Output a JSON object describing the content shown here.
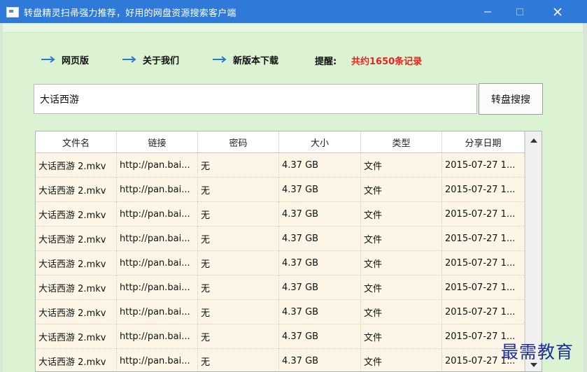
{
  "window": {
    "title": "转盘精灵扫帚强力推荐，好用的网盘资源搜索客户端",
    "icon": "app-window-icon"
  },
  "nav": {
    "links": [
      {
        "label": "网页版",
        "icon": "arrow-right-icon"
      },
      {
        "label": "关于我们",
        "icon": "arrow-right-icon"
      },
      {
        "label": "新版本下载",
        "icon": "arrow-right-icon"
      }
    ],
    "hint_label": "提醒:",
    "hint_value": "共约1650条记录",
    "accent_color": "#e0281f",
    "arrow_color": "#2a78d0"
  },
  "search": {
    "value": "大话西游",
    "button_label": "转盘搜搜"
  },
  "table": {
    "columns": [
      "文件名",
      "链接",
      "密码",
      "大小",
      "类型",
      "分享日期"
    ],
    "rows": [
      [
        "大话西游 2.mkv",
        "http://pan.bai...",
        "无",
        "4.37 GB",
        "文件",
        "2015-07-27 1..."
      ],
      [
        "大话西游 2.mkv",
        "http://pan.bai...",
        "无",
        "4.37 GB",
        "文件",
        "2015-07-27 1..."
      ],
      [
        "大话西游 2.mkv",
        "http://pan.bai...",
        "无",
        "4.37 GB",
        "文件",
        "2015-07-27 1..."
      ],
      [
        "大话西游 2.mkv",
        "http://pan.bai...",
        "无",
        "4.37 GB",
        "文件",
        "2015-07-27 1..."
      ],
      [
        "大话西游 2.mkv",
        "http://pan.bai...",
        "无",
        "4.37 GB",
        "文件",
        "2015-07-27 1..."
      ],
      [
        "大话西游 2.mkv",
        "http://pan.bai...",
        "无",
        "4.37 GB",
        "文件",
        "2015-07-27 1..."
      ],
      [
        "大话西游 2.mkv",
        "http://pan.bai...",
        "无",
        "4.37 GB",
        "文件",
        "2015-07-27 1..."
      ],
      [
        "大话西游 2.mkv",
        "http://pan.bai...",
        "无",
        "4.37 GB",
        "文件",
        "2015-07-27 1..."
      ],
      [
        "大话西游 2.mkv",
        "http://pan.bai...",
        "无",
        "4.37 GB",
        "文件",
        "2015-07-27 1..."
      ]
    ]
  },
  "watermark": {
    "text": "最需教育"
  }
}
